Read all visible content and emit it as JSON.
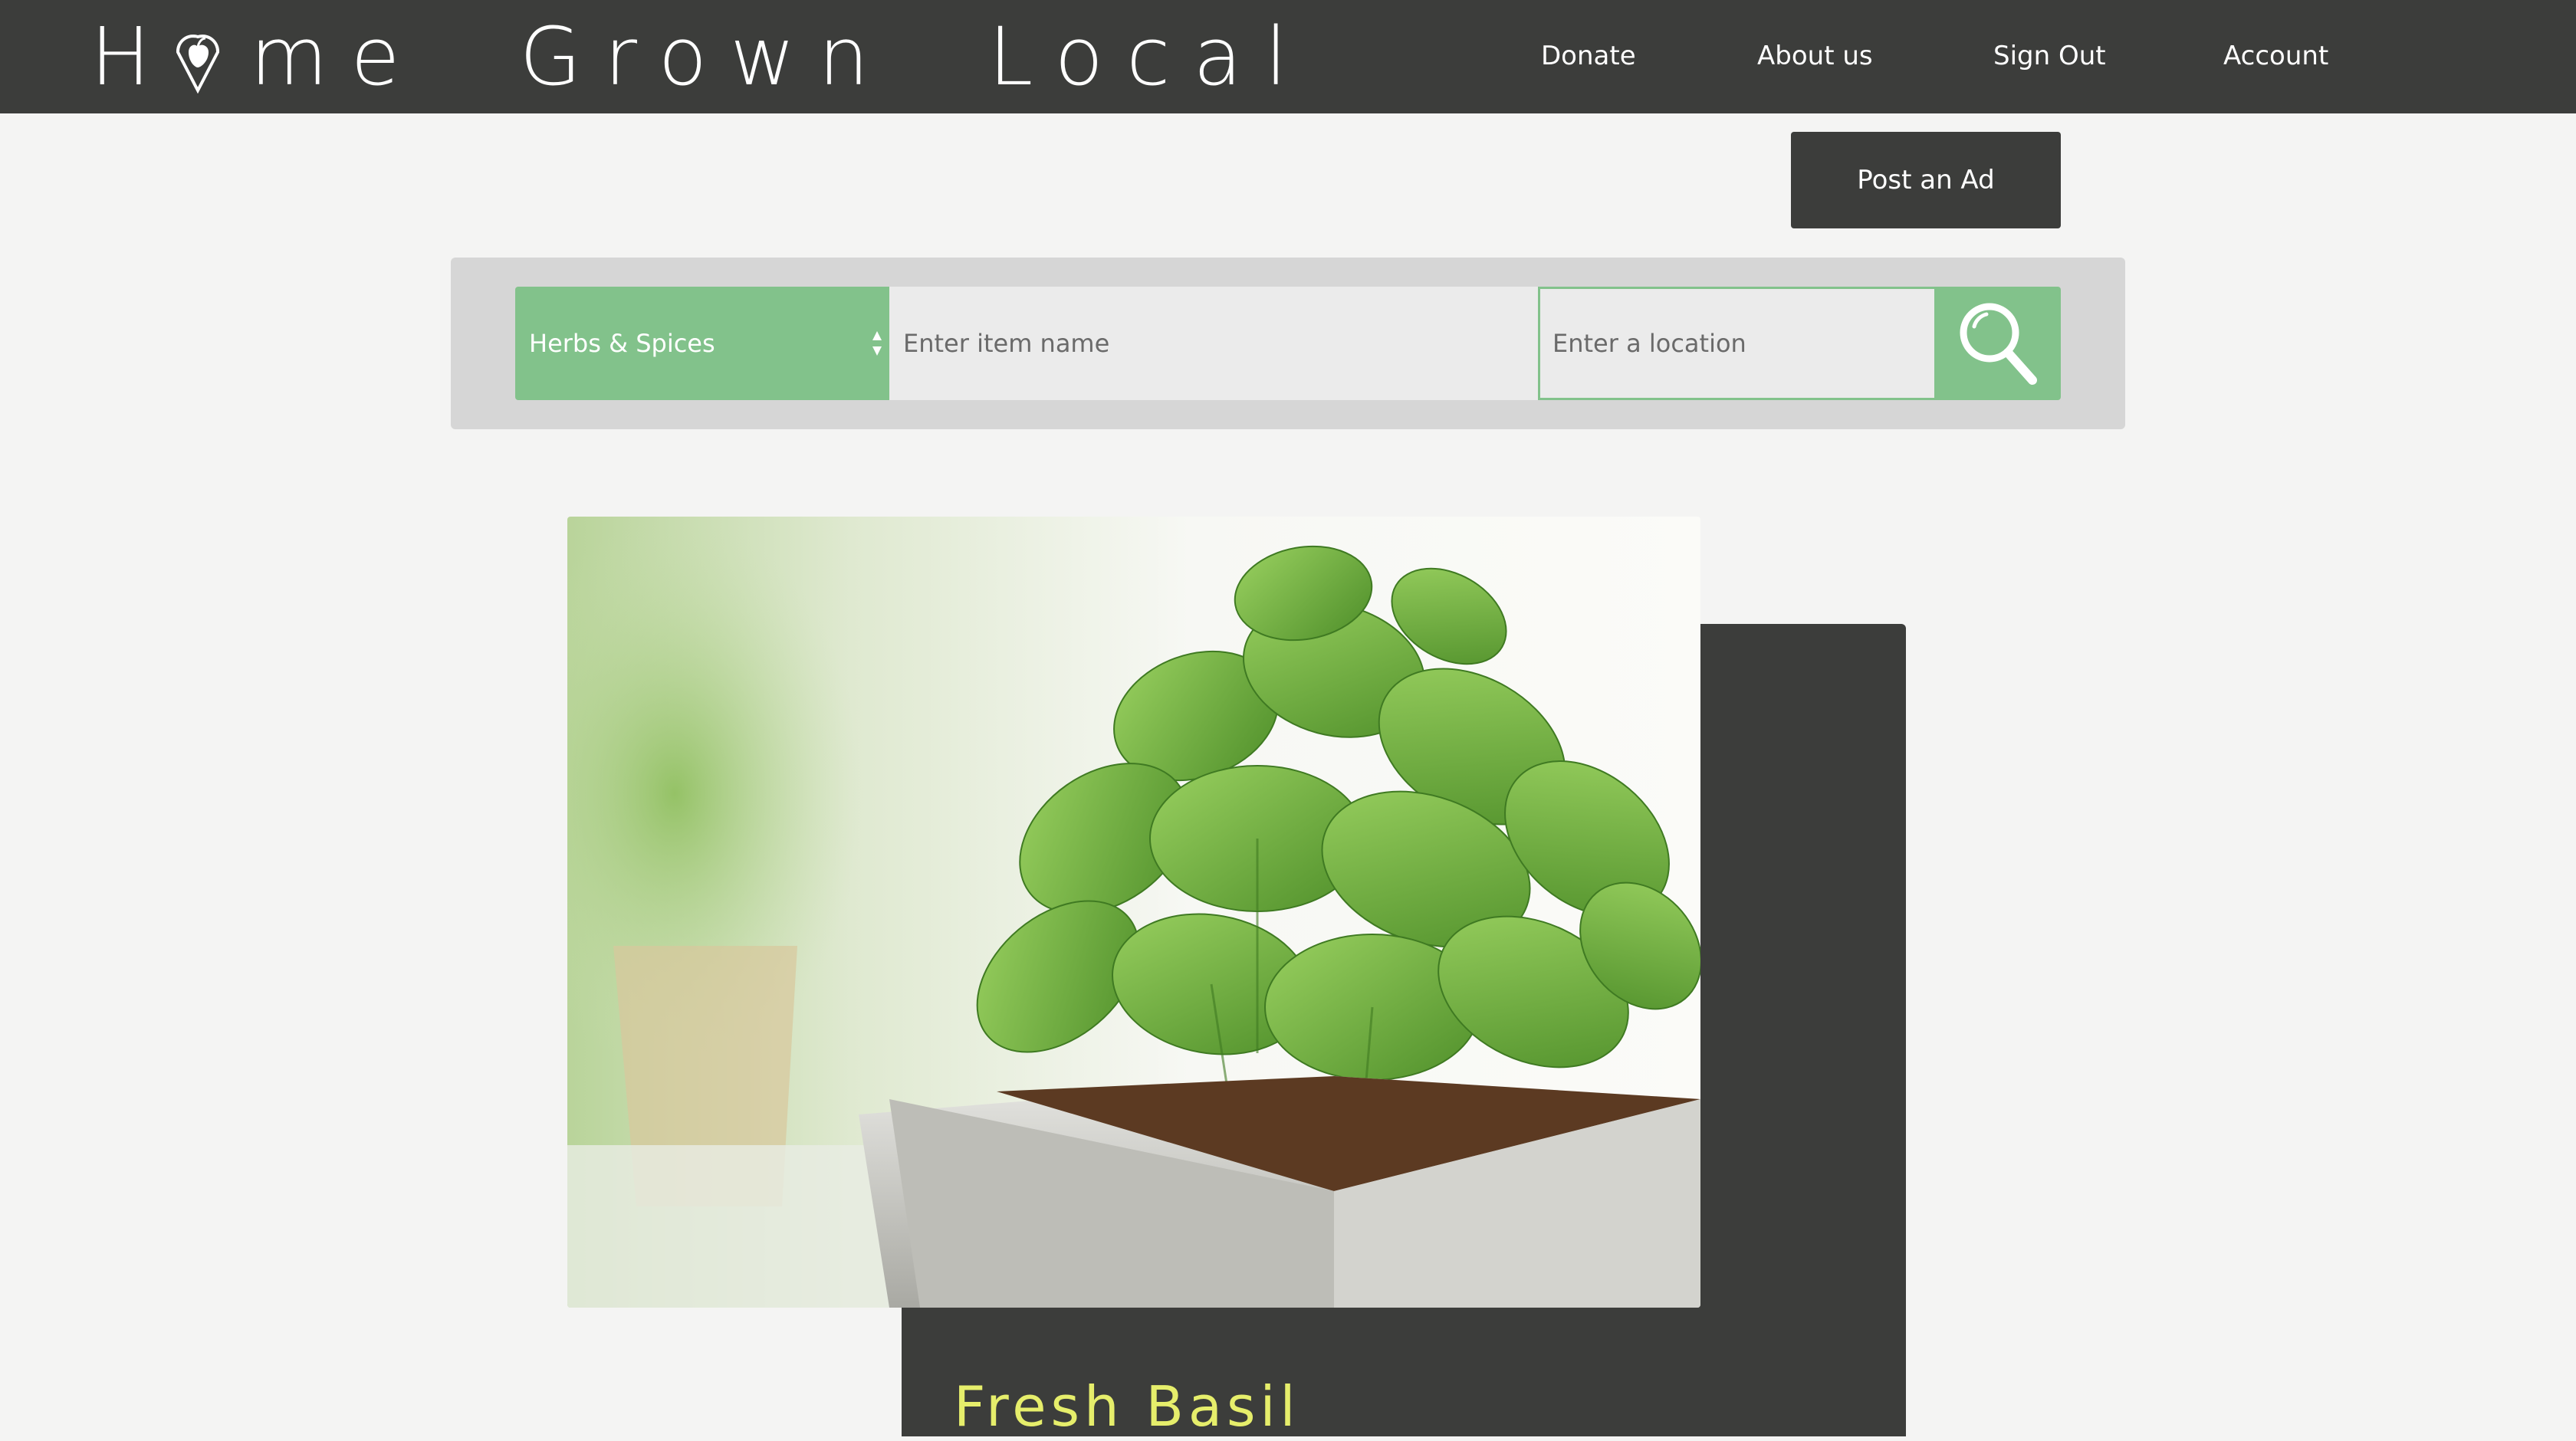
{
  "brand": {
    "logo_text_before": "H",
    "logo_text_after": "me  Grown  Local",
    "logo_icon": "apple-heart-icon"
  },
  "nav": {
    "items": [
      {
        "label": "Donate"
      },
      {
        "label": "About us"
      },
      {
        "label": "Sign Out"
      },
      {
        "label": "Account"
      }
    ]
  },
  "actions": {
    "post_ad_label": "Post an Ad"
  },
  "search": {
    "category_selected": "Herbs & Spices",
    "item_placeholder": "Enter item name",
    "location_placeholder": "Enter a location",
    "search_icon": "search-icon"
  },
  "listing": {
    "title": "Fresh Basil",
    "image_subject": "potted basil plant"
  },
  "colors": {
    "header_bg": "#3c3d3b",
    "accent_green": "#82c28b",
    "title_yellow": "#e6ee6b",
    "page_bg": "#f4f4f3"
  }
}
